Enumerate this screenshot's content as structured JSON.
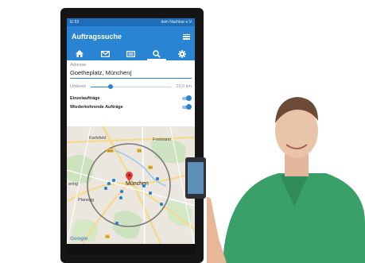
{
  "status_bar": {
    "time": "11:53",
    "carrier": "dein Nachbar e.V."
  },
  "app_bar": {
    "title": "Auftragssuche"
  },
  "tabs": [
    {
      "icon": "home-icon"
    },
    {
      "icon": "envelope-icon"
    },
    {
      "icon": "list-icon"
    },
    {
      "icon": "search-icon",
      "active": true
    },
    {
      "icon": "gear-icon"
    }
  ],
  "form": {
    "address_label": "Adresse",
    "address_value": "Goetheplatz, München",
    "radius_label": "Umkreis",
    "radius_value": "10,0 km",
    "radius_fraction": 0.25,
    "toggle_single_label": "Einzelaufträge",
    "toggle_single_on": true,
    "toggle_recurring_label": "Wiederkehrende Aufträge",
    "toggle_recurring_on": true
  },
  "map": {
    "labels": {
      "karlsfeld": "Karlsfeld",
      "freimann": "Freimann",
      "muenchen": "München",
      "ering": "ering",
      "planegg": "Planegg",
      "muenchen_short": "hen",
      "google": "Google"
    },
    "road_shields": [
      "504",
      "13",
      "99",
      "11"
    ]
  },
  "colors": {
    "primary": "#2a84d4",
    "status": "#1d6db8",
    "marker": "#e53935",
    "pin": "#1e7fd6"
  }
}
